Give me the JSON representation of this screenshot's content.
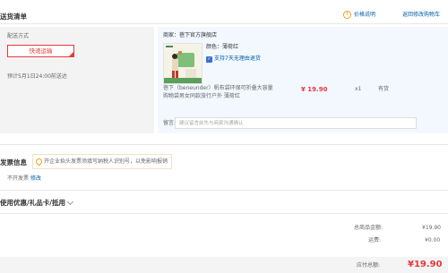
{
  "header": {
    "title": "送货清单",
    "price_link": "价格说明",
    "back_link": "返回修改购物车",
    "info_icon": "info-circle-icon"
  },
  "delivery": {
    "label": "配送方式",
    "option": "快递运输",
    "estimate": "预计5月1日24:00前送达"
  },
  "shop": {
    "label": "商家：",
    "name": "蓓下官方旗舰店"
  },
  "product": {
    "color_label": "颜色：",
    "color_value": "薄荷红",
    "return_badge": "支持7天无理由退货",
    "name_line1": "蓓下（beneunder）帆布袋环保可折叠大容量",
    "name_line2": "购物袋男女同款旅行户外 薄荷红",
    "price": "¥ 19.90",
    "quantity": "x1",
    "stock": "有货",
    "image_icon": "product-thumbnail"
  },
  "remark": {
    "label": "留言:",
    "placeholder": "建议留言前先与商家沟通确认"
  },
  "invoice": {
    "title": "发票信息",
    "tip": "开企业抬头发票须填写纳税人识别号，以免影响报销",
    "value": "不开发票",
    "edit_link": "修改"
  },
  "coupon": {
    "title": "使用优惠/礼品卡/抵用",
    "chevron": "chevron-down-icon"
  },
  "totals": {
    "goods_label": "总商品金额:",
    "goods_value": "¥19.90",
    "shipping_label": "运费:",
    "shipping_value": "¥0.00",
    "payable_label": "应付总额:",
    "payable_value": "¥19.90"
  },
  "colors": {
    "accent": "#e4393c",
    "link": "#005ea7",
    "panel": "#f2f8fe"
  }
}
